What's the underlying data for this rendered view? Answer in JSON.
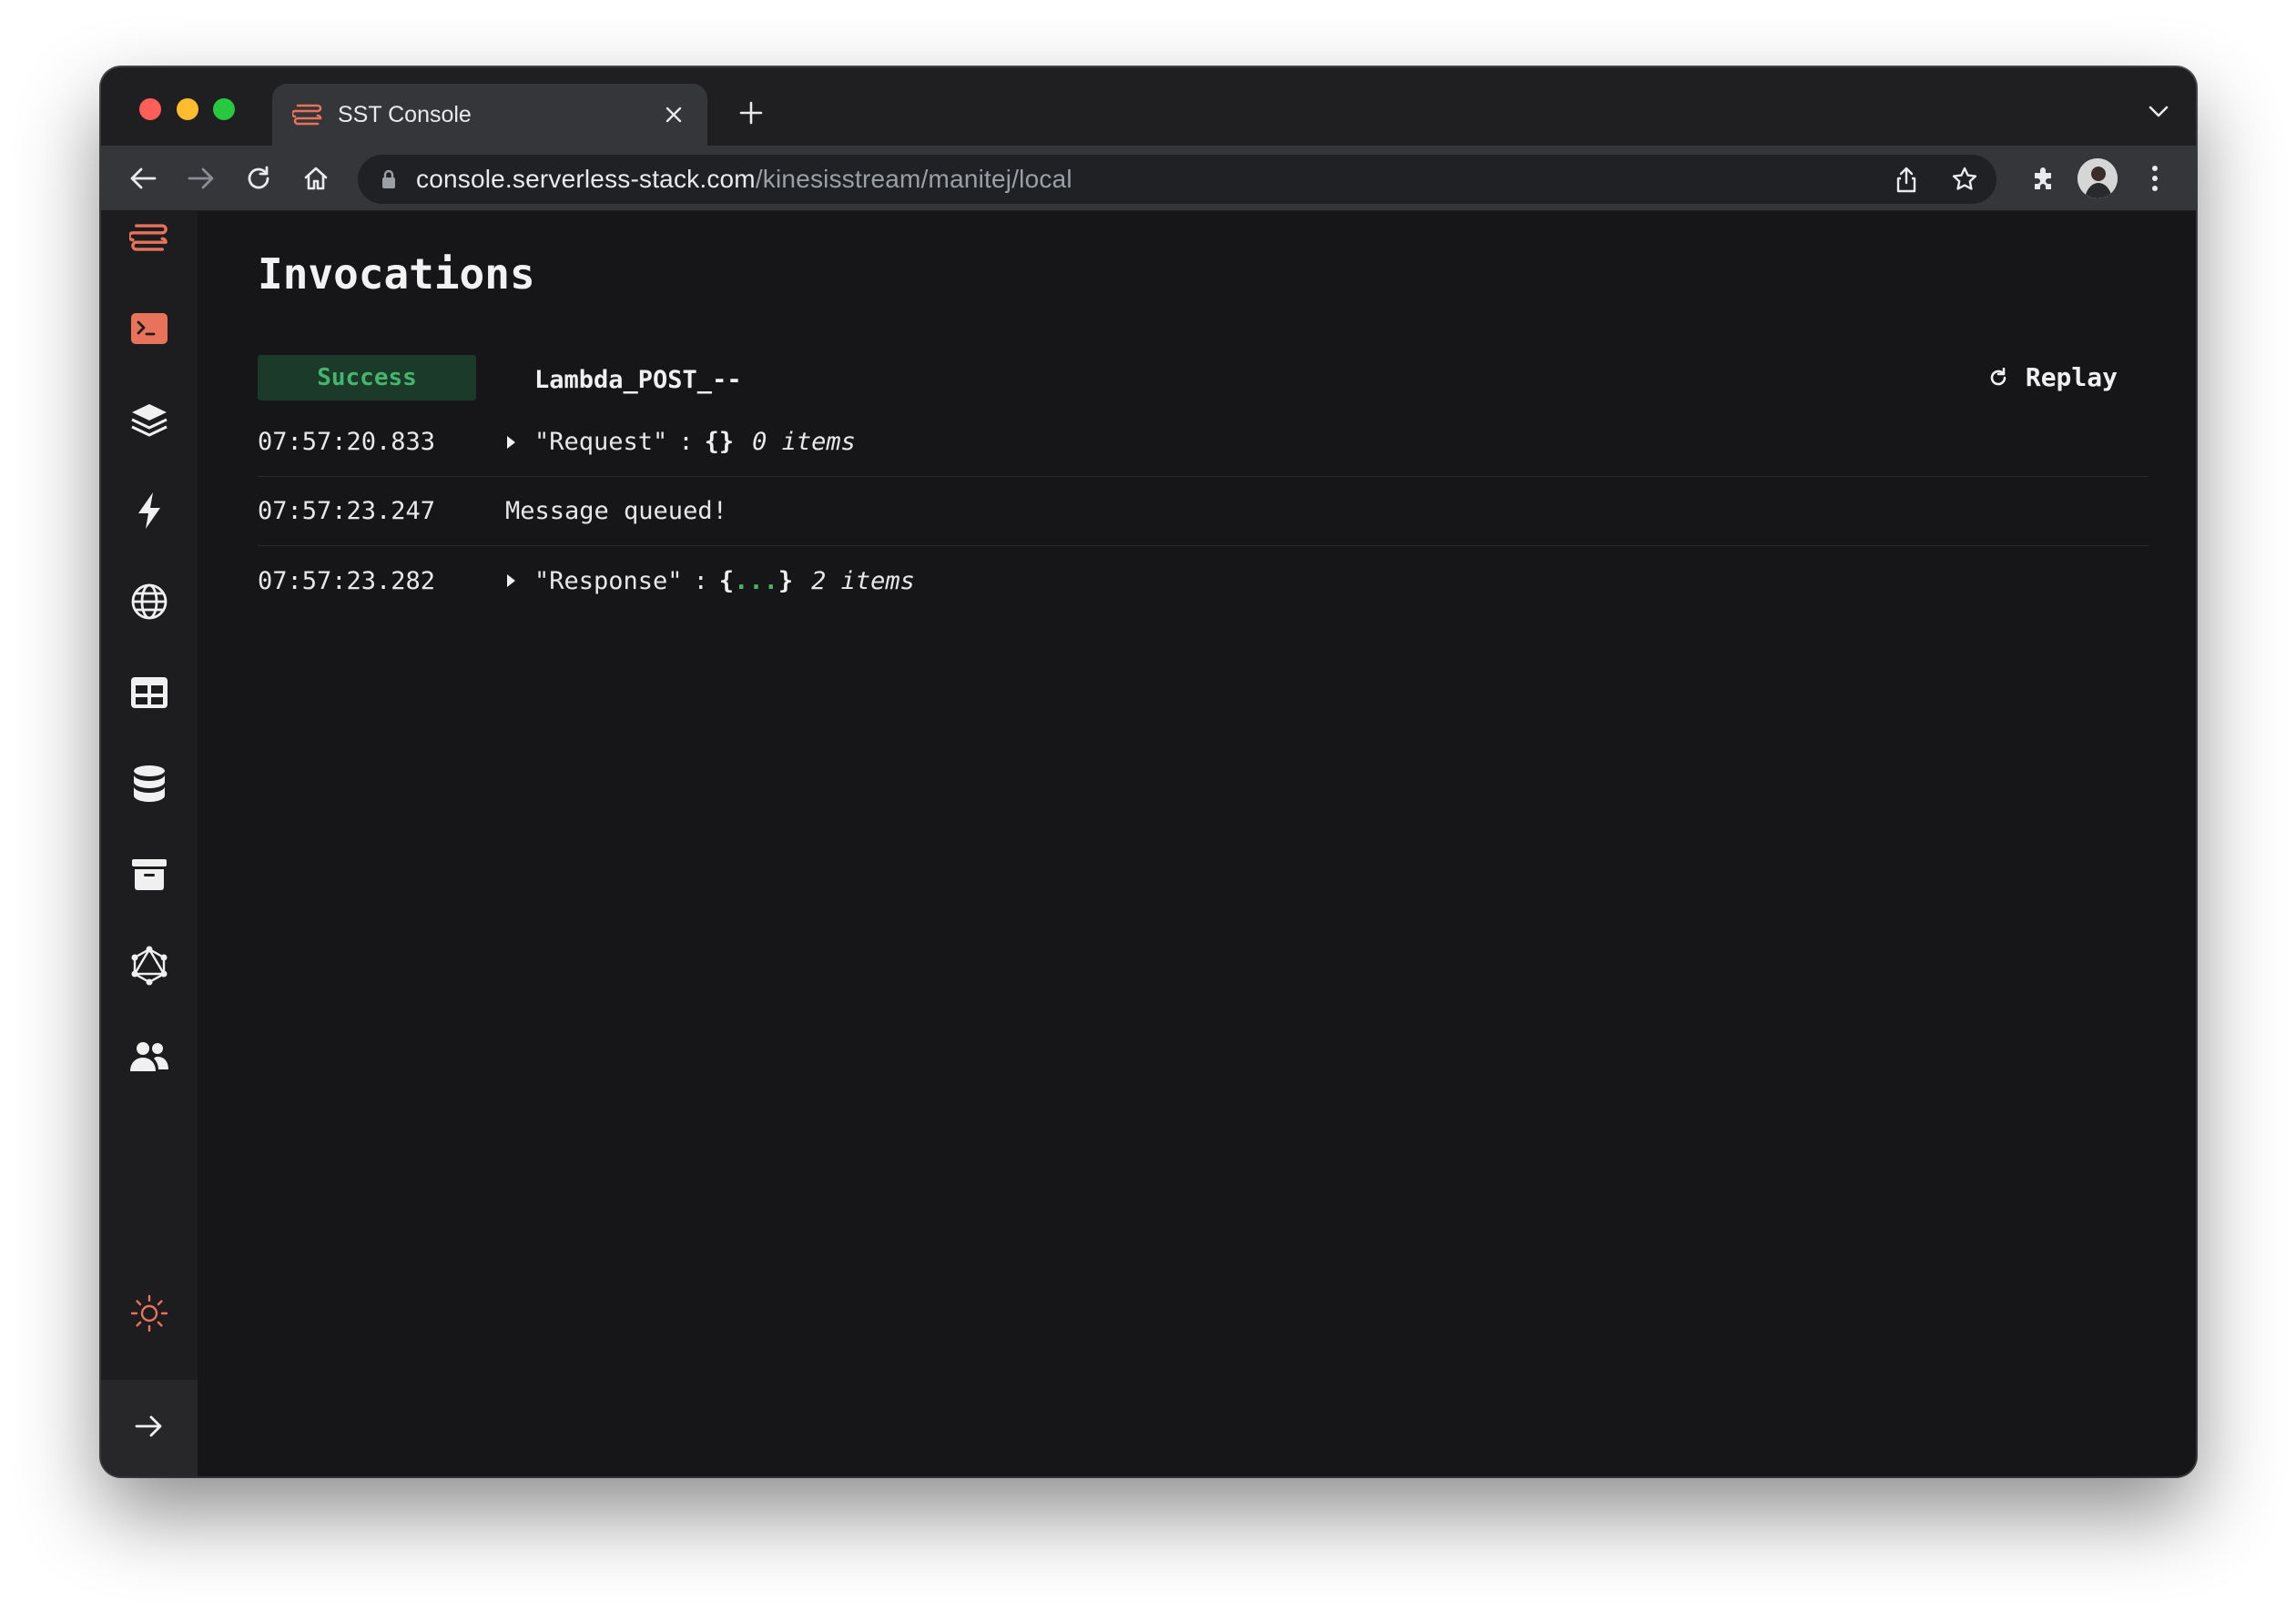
{
  "browser": {
    "tab_title": "SST Console",
    "url_host": "console.serverless-stack.com",
    "url_path": "/kinesisstream/manitej/local"
  },
  "sidebar": {
    "items": [
      {
        "name": "sst-logo-icon"
      },
      {
        "name": "terminal-icon"
      },
      {
        "name": "stacks-icon"
      },
      {
        "name": "functions-icon"
      },
      {
        "name": "api-globe-icon"
      },
      {
        "name": "dynamodb-table-icon"
      },
      {
        "name": "rds-database-icon"
      },
      {
        "name": "buckets-archive-icon"
      },
      {
        "name": "graphql-icon"
      },
      {
        "name": "cognito-users-icon"
      }
    ]
  },
  "colors": {
    "accent": "#e8735a",
    "success_bg": "#1b3a2a",
    "success_text": "#45b56e",
    "background": "#161618"
  },
  "main": {
    "title": "Invocations",
    "status": "Success",
    "function_name": "Lambda_POST_--",
    "replay_label": "Replay",
    "logs": [
      {
        "timestamp": "07:57:20.833",
        "key": "\"Request\"",
        "colon": ":",
        "value": "{}",
        "count": "0 items"
      },
      {
        "timestamp": "07:57:23.247",
        "message": "Message queued!"
      },
      {
        "timestamp": "07:57:23.282",
        "key": "\"Response\"",
        "colon": ":",
        "brace_open": "{",
        "ellipsis": "...",
        "brace_close": "}",
        "count": "2 items"
      }
    ]
  }
}
